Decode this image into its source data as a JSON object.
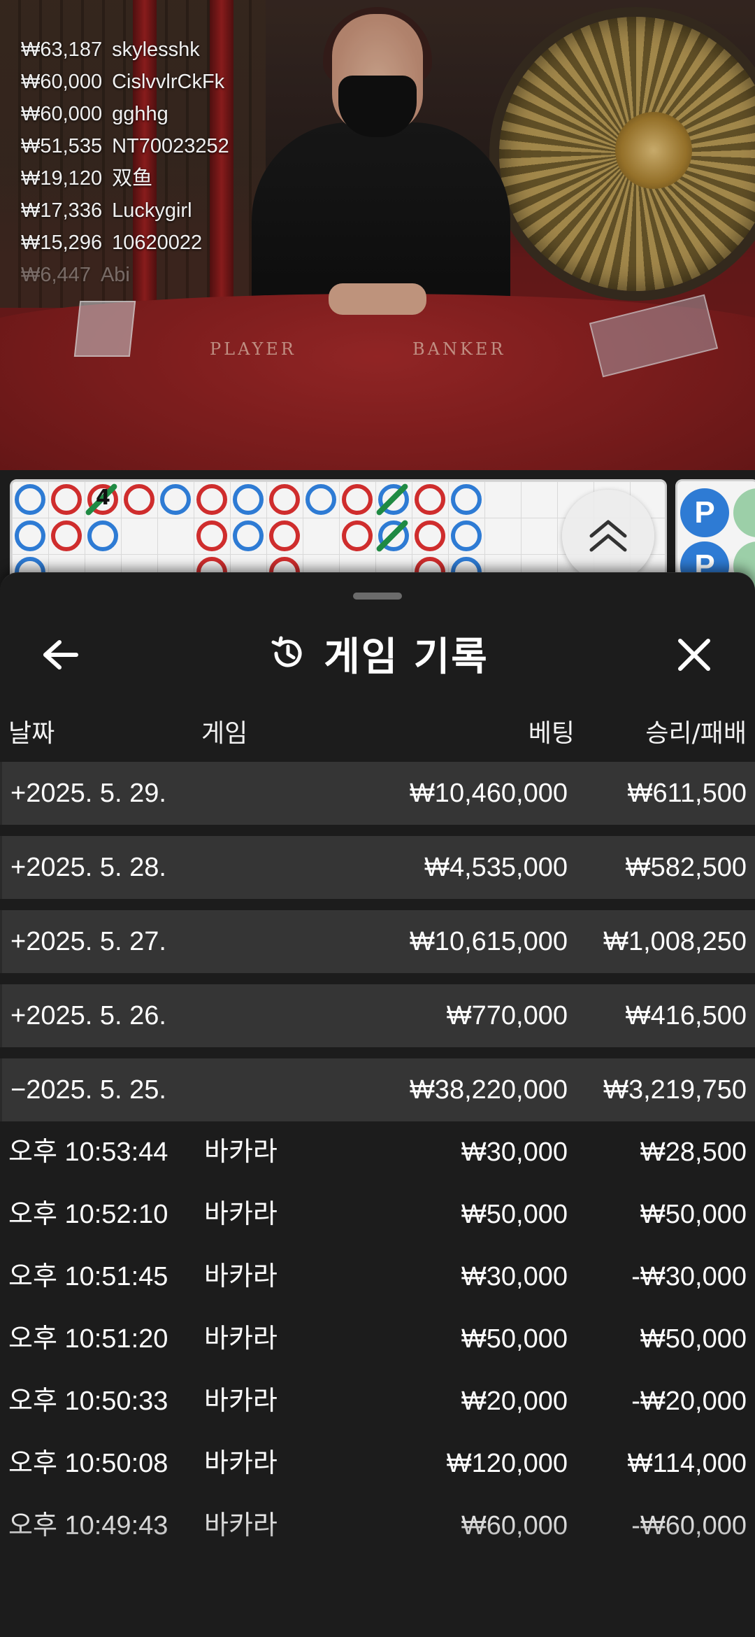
{
  "video": {
    "table_labels": [
      "PLAYER",
      "BANKER"
    ],
    "bet_feed": [
      {
        "amount": "₩63,187",
        "user": "skylesshk"
      },
      {
        "amount": "₩60,000",
        "user": "CislvvlrCkFk"
      },
      {
        "amount": "₩60,000",
        "user": "gghhg"
      },
      {
        "amount": "₩51,535",
        "user": "NT70023252"
      },
      {
        "amount": "₩19,120",
        "user": "双鱼"
      },
      {
        "amount": "₩17,336",
        "user": "Luckygirl"
      },
      {
        "amount": "₩15,296",
        "user": "10620022"
      },
      {
        "amount": "₩6,447",
        "user": "Abi"
      }
    ]
  },
  "roadmap": {
    "tie_count_label": "4",
    "bead_label": "P",
    "colors": {
      "banker": "#2e7bd4",
      "player": "#cf2d2d",
      "tie": "#1f8a43"
    }
  },
  "sheet": {
    "title": "게임 기록",
    "icons": {
      "back": "arrow-left-icon",
      "history": "history-icon",
      "close": "close-icon",
      "expand": "chevron-double-up-icon"
    },
    "columns": {
      "date": "날짜",
      "game": "게임",
      "bet": "베팅",
      "winloss": "승리/패배"
    },
    "days": [
      {
        "date": "+2025. 5. 29.",
        "bet": "₩10,460,000",
        "winloss": "₩611,500"
      },
      {
        "date": "+2025. 5. 28.",
        "bet": "₩4,535,000",
        "winloss": "₩582,500"
      },
      {
        "date": "+2025. 5. 27.",
        "bet": "₩10,615,000",
        "winloss": "₩1,008,250"
      },
      {
        "date": "+2025. 5. 26.",
        "bet": "₩770,000",
        "winloss": "₩416,500"
      },
      {
        "date": "−2025. 5. 25.",
        "bet": "₩38,220,000",
        "winloss": "₩3,219,750"
      }
    ],
    "rounds": [
      {
        "time": "오후 10:53:44",
        "game": "바카라",
        "bet": "₩30,000",
        "winloss": "₩28,500"
      },
      {
        "time": "오후 10:52:10",
        "game": "바카라",
        "bet": "₩50,000",
        "winloss": "₩50,000"
      },
      {
        "time": "오후 10:51:45",
        "game": "바카라",
        "bet": "₩30,000",
        "winloss": "-₩30,000"
      },
      {
        "time": "오후 10:51:20",
        "game": "바카라",
        "bet": "₩50,000",
        "winloss": "₩50,000"
      },
      {
        "time": "오후 10:50:33",
        "game": "바카라",
        "bet": "₩20,000",
        "winloss": "-₩20,000"
      },
      {
        "time": "오후 10:50:08",
        "game": "바카라",
        "bet": "₩120,000",
        "winloss": "₩114,000"
      },
      {
        "time": "오후 10:49:43",
        "game": "바카라",
        "bet": "₩60,000",
        "winloss": "-₩60,000"
      }
    ]
  }
}
